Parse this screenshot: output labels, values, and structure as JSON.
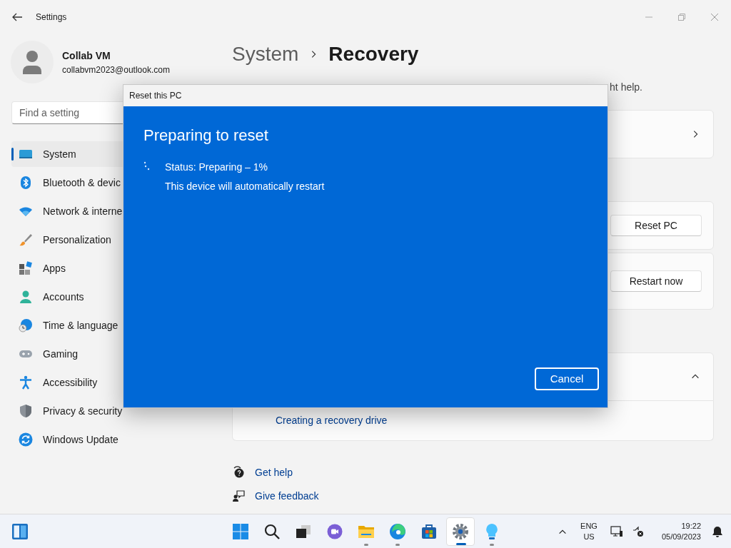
{
  "window": {
    "title": "Settings"
  },
  "user": {
    "name": "Collab VM",
    "email": "collabvm2023@outlook.com"
  },
  "search": {
    "placeholder": "Find a setting"
  },
  "sidebar": {
    "items": [
      {
        "label": "System",
        "kind": "system",
        "selected": true
      },
      {
        "label": "Bluetooth & devic",
        "kind": "bluetooth",
        "selected": false
      },
      {
        "label": "Network & interne",
        "kind": "network",
        "selected": false
      },
      {
        "label": "Personalization",
        "kind": "brush",
        "selected": false
      },
      {
        "label": "Apps",
        "kind": "apps",
        "selected": false
      },
      {
        "label": "Accounts",
        "kind": "accounts",
        "selected": false
      },
      {
        "label": "Time & language",
        "kind": "time",
        "selected": false
      },
      {
        "label": "Gaming",
        "kind": "gaming",
        "selected": false
      },
      {
        "label": "Accessibility",
        "kind": "accessibility",
        "selected": false
      },
      {
        "label": "Privacy & security",
        "kind": "shield",
        "selected": false
      },
      {
        "label": "Windows Update",
        "kind": "update",
        "selected": false
      }
    ]
  },
  "breadcrumb": {
    "parent": "System",
    "current": "Recovery"
  },
  "description": "ht help.",
  "cards": [
    {
      "kind": "chevron"
    },
    {
      "kind": "button",
      "button": "Reset PC"
    },
    {
      "kind": "button",
      "button": "Restart now"
    },
    {
      "kind": "expander",
      "expanded": true,
      "children": [
        {
          "label": "Creating a recovery drive"
        }
      ]
    }
  ],
  "links": [
    {
      "label": "Get help",
      "kind": "help"
    },
    {
      "label": "Give feedback",
      "kind": "feedback"
    }
  ],
  "dialog": {
    "title": "Reset this PC",
    "heading": "Preparing to reset",
    "status": "Status: Preparing – 1%",
    "note": "This device will automatically restart",
    "button": "Cancel"
  },
  "taskbar": {
    "apps": [
      {
        "kind": "start",
        "running": false,
        "selected": false
      },
      {
        "kind": "search",
        "running": false,
        "selected": false
      },
      {
        "kind": "taskview",
        "running": false,
        "selected": false
      },
      {
        "kind": "chat",
        "running": false,
        "selected": false
      },
      {
        "kind": "explorer",
        "running": true,
        "selected": false
      },
      {
        "kind": "edge",
        "running": true,
        "selected": false
      },
      {
        "kind": "store",
        "running": false,
        "selected": false
      },
      {
        "kind": "settings",
        "running": true,
        "selected": true
      },
      {
        "kind": "tips",
        "running": true,
        "selected": false
      }
    ],
    "language": "ENG",
    "region": "US",
    "time": "19:22",
    "date": "05/09/2023"
  }
}
